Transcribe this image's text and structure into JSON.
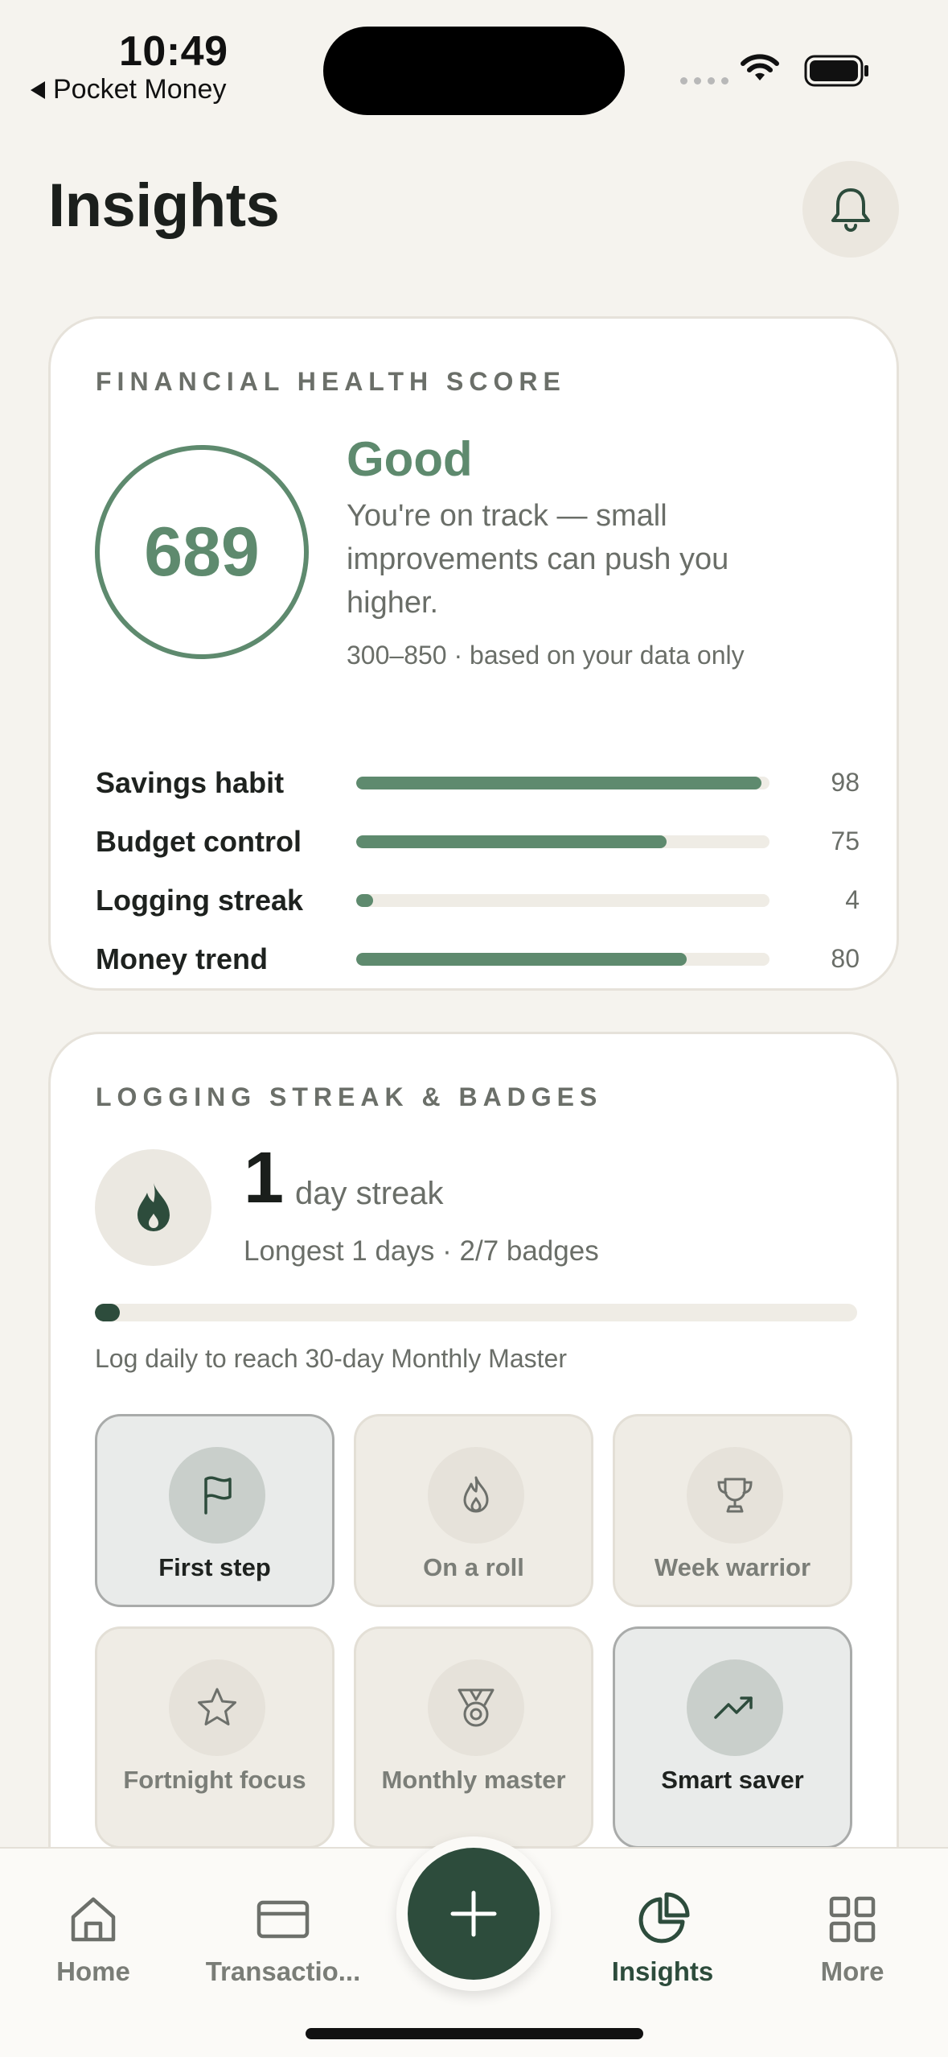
{
  "status_bar": {
    "time": "10:49",
    "back_app": "Pocket Money",
    "icons": [
      "cellular-dots-icon",
      "wifi-icon",
      "battery-icon"
    ]
  },
  "header": {
    "title": "Insights",
    "bell_icon": "bell-icon"
  },
  "health": {
    "section_label": "FINANCIAL HEALTH SCORE",
    "score": "689",
    "rating": "Good",
    "description": "You're on track — small improvements can push you higher.",
    "range_note": "300–850 · based on your data only",
    "metrics": [
      {
        "name": "Savings habit",
        "value": 98
      },
      {
        "name": "Budget control",
        "value": 75
      },
      {
        "name": "Logging streak",
        "value": 4
      },
      {
        "name": "Money trend",
        "value": 80
      }
    ]
  },
  "streak": {
    "section_label": "LOGGING STREAK & BADGES",
    "count": "1",
    "unit": "day streak",
    "subtitle": "Longest 1 days · 2/7 badges",
    "progress_fraction": 0.033,
    "hint": "Log daily to reach 30-day Monthly Master",
    "badges": [
      {
        "label": "First step",
        "icon": "flag-icon",
        "earned": true
      },
      {
        "label": "On a roll",
        "icon": "flame-icon",
        "earned": false
      },
      {
        "label": "Week warrior",
        "icon": "trophy-icon",
        "earned": false
      },
      {
        "label": "Fortnight focus",
        "icon": "star-icon",
        "earned": false
      },
      {
        "label": "Monthly master",
        "icon": "medal-icon",
        "earned": false
      },
      {
        "label": "Smart saver",
        "icon": "trending-up-icon",
        "earned": true
      }
    ]
  },
  "nav": {
    "items": [
      {
        "label": "Home",
        "icon": "home-icon",
        "active": false
      },
      {
        "label": "Transactio...",
        "icon": "card-icon",
        "active": false
      },
      {
        "label": "Insights",
        "icon": "pie-chart-icon",
        "active": true
      },
      {
        "label": "More",
        "icon": "grid-icon",
        "active": false
      }
    ],
    "fab_icon": "plus-icon"
  },
  "colors": {
    "accent_green": "#5e8a6e",
    "dark_green": "#2d4c3c",
    "background": "#f5f3ee"
  }
}
